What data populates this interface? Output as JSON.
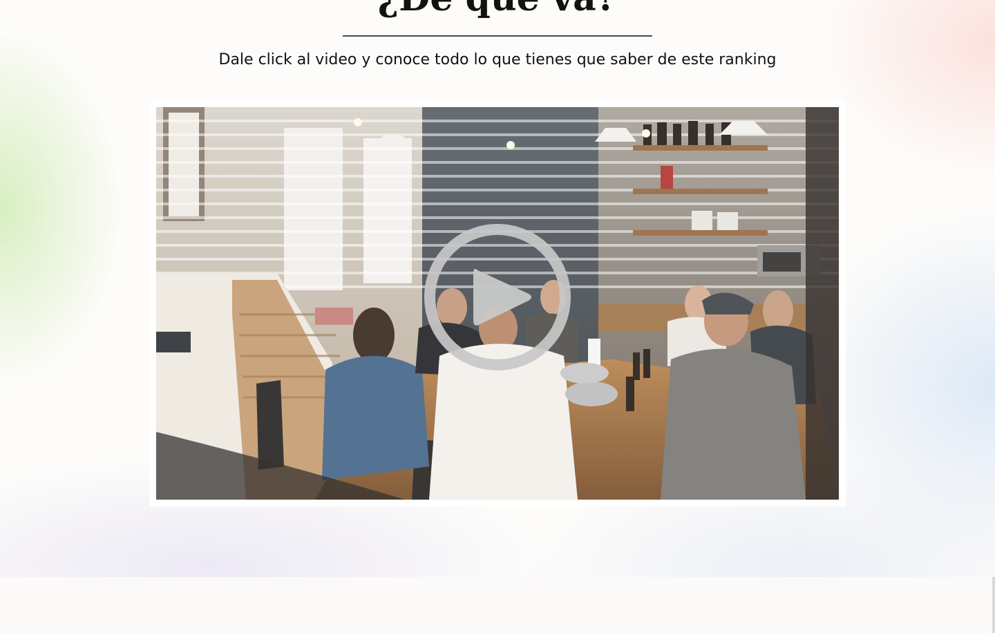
{
  "section": {
    "title": "¿De qué va?",
    "subtitle": "Dale click al video y conoce todo lo que tienes que saber de este ranking"
  },
  "video": {
    "thumbnail": "people-meeting-around-kitchen-table",
    "play_icon": "play-circle-icon"
  },
  "colors": {
    "title_text": "#14120f",
    "rule": "#4a4a4a",
    "frame": "#ffffff",
    "play_overlay": "#c8c8c8"
  }
}
